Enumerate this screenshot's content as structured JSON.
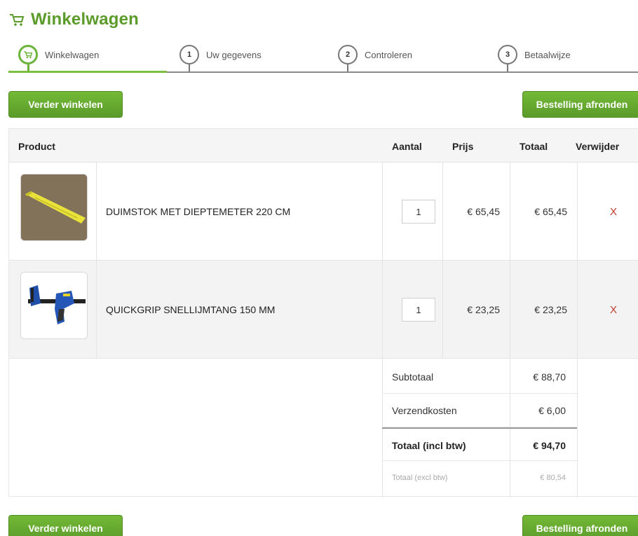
{
  "page": {
    "title": "Winkelwagen"
  },
  "steps": [
    {
      "label": "Winkelwagen",
      "number": ""
    },
    {
      "label": "Uw gegevens",
      "number": "1"
    },
    {
      "label": "Controleren",
      "number": "2"
    },
    {
      "label": "Betaalwijze",
      "number": "3"
    }
  ],
  "buttons": {
    "continue_shopping": "Verder winkelen",
    "checkout": "Bestelling afronden"
  },
  "table": {
    "headers": {
      "product": "Product",
      "quantity": "Aantal",
      "price": "Prijs",
      "total": "Totaal",
      "remove": "Verwijder"
    },
    "rows": [
      {
        "name": "DUIMSTOK MET DIEPTEMETER 220 CM",
        "quantity": "1",
        "price": "€ 65,45",
        "total": "€ 65,45",
        "remove": "X",
        "image_icon": "folding-ruler-image"
      },
      {
        "name": "QUICKGRIP SNELLIJMTANG 150 MM",
        "quantity": "1",
        "price": "€ 23,25",
        "total": "€ 23,25",
        "remove": "X",
        "image_icon": "clamp-image"
      }
    ]
  },
  "summary": {
    "subtotal_label": "Subtotaal",
    "subtotal_value": "€ 88,70",
    "shipping_label": "Verzendkosten",
    "shipping_value": "€ 6,00",
    "total_incl_label": "Totaal (incl btw)",
    "total_incl_value": "€ 94,70",
    "total_excl_label": "Totaal (excl btw)",
    "total_excl_value": "€ 80,54"
  },
  "colors": {
    "accent": "#5a9b2a",
    "remove": "#c0392b"
  }
}
